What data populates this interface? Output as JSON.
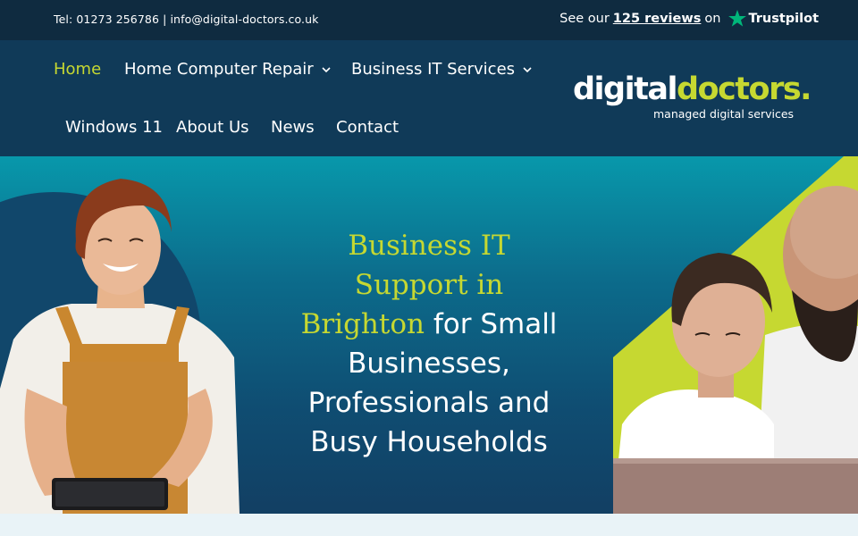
{
  "topbar": {
    "phone": "Tel: 01273 256786",
    "separator": "|",
    "email": "info@digital-doctors.co.uk",
    "reviews_prefix": "See our",
    "reviews_count": "125 reviews",
    "reviews_suffix": "on",
    "trustpilot": "Trustpilot",
    "trustpilot_color": "#00b67a"
  },
  "nav": {
    "items": [
      {
        "label": "Home",
        "active": true
      },
      {
        "label": "Home Computer Repair",
        "dropdown": true
      },
      {
        "label": "Business IT Services",
        "dropdown": true
      },
      {
        "label": "Windows 11"
      },
      {
        "label": "About Us"
      },
      {
        "label": "News"
      },
      {
        "label": "Contact"
      }
    ],
    "active_color": "#c6d831"
  },
  "logo": {
    "part1": "digital",
    "part2": "doctors.",
    "tagline": "managed digital services"
  },
  "hero": {
    "heading_highlight_1": "Business IT",
    "heading_highlight_2": "Support in",
    "heading_highlight_3": "Brighton",
    "heading_rest_1": " for Small",
    "heading_rest_2": "Businesses,",
    "heading_rest_3": "Professionals and",
    "heading_rest_4": "Busy Households",
    "accent_color": "#c6d831",
    "left_image": "woman-with-tablet-photo",
    "right_image": "father-and-son-laptop-photo"
  },
  "colors": {
    "topbar_bg": "#0f2b40",
    "navbar_bg": "#103a58",
    "hero_top": "#0898ab",
    "hero_bottom": "#123f63"
  }
}
